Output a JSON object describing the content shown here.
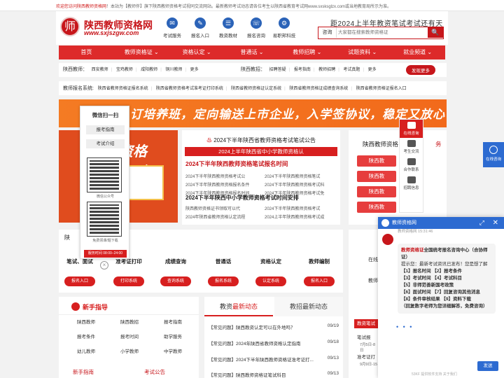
{
  "notice": {
    "highlight": "欢迎您访问陕西教师资格网",
    "text": "！本站为【教师伴】旗下陕西教师资格考试视同交流网站。最新教师考试动态请各位考生以陕西省教育考试网www.sxsksglzx.com或当地教育局所示为准。"
  },
  "header": {
    "logo_char": "师",
    "site_name": "陕西教师资格网",
    "site_url": "www.sxjszgw.com",
    "slogan": "距2024上半年教资笔试考试还有天",
    "quick": [
      {
        "label": "考试服务",
        "icon": "✉"
      },
      {
        "label": "报名入口",
        "icon": "✎"
      },
      {
        "label": "教资教材",
        "icon": "☰"
      },
      {
        "label": "报名咨询",
        "icon": "☏"
      },
      {
        "label": "易职邦科技",
        "icon": "⚙"
      }
    ],
    "search_label": "咨询",
    "search_placeholder": "大家都在搜索教师资格证",
    "search_icon": "🔍"
  },
  "nav": [
    "首页",
    "教师资格证 ⌄",
    "资格认定 ⌄",
    "普通话 ⌄",
    "教师招聘 ⌄",
    "试题资料 ⌄",
    "就业频道 ⌄"
  ],
  "region": {
    "title": "陕西教师：",
    "items": [
      "西安教师",
      "宝鸡教师",
      "咸阳教师",
      "铜川教师",
      "更多"
    ]
  },
  "recruit": {
    "title": "陕西教招：",
    "items": [
      "招聘答疑",
      "报考指南",
      "教师招聘",
      "考试真题",
      "更多"
    ],
    "button": "发现更多"
  },
  "system": {
    "title": "教师报名系统:",
    "items": [
      "陕西省教师资格证报名系统",
      "陕西省教师资格考试准考证打印系统",
      "陕西省教师资格证认定系统",
      "陕西省教师资格证成绩查询系统",
      "陕西省教师资格证报名入口"
    ]
  },
  "banner": {
    "text": "订培养班，定向输送上市企业，入学签协议，稳定又放心"
  },
  "promo": {
    "big": "资格",
    "sub": "包"
  },
  "qr": {
    "title": "微信扫一扫",
    "btn1": "报考指南",
    "btn2": "考试介绍",
    "cap1": "微信公众号",
    "cap2": "免费领课/题下载",
    "time": "服务时间 08:00–24:00"
  },
  "news": {
    "heading": "2024下半年陕西省教师资格考试笔试公告",
    "redbar": "2024上半年陕西省中小学教师资格认",
    "headline1": "2024下半年陕西教师资格笔试报名时间",
    "left1": [
      "2024下半年陕西教师资格考试公",
      "2024下半年陕西教师资格报名条件",
      "2024下半年陕西教师资格报名时间"
    ],
    "right1": [
      "2024下半年陕西教师资格笔试",
      "2024下半年陕西教师资格考试科",
      "2024下半年陕西教师资格考试免"
    ],
    "headline2": "2024下半年陕西中小学教师资格考试时间安排",
    "left2": [
      "陕西教师资格证书领取可以代",
      "2024年陕西省教师资格认定流程"
    ],
    "right2": [
      "2024下半年陕西教师资格考试",
      "2024上半年陕西教师资格考试成"
    ]
  },
  "right": {
    "title": "陕西教师资格",
    "more": "务",
    "boxes": [
      "陕西教",
      "陕西教",
      "陕西教",
      "陕西教"
    ]
  },
  "side": [
    {
      "label": "在线咨询"
    },
    {
      "label": "考生交流"
    },
    {
      "label": "合作联系"
    },
    {
      "label": "招聘信息"
    }
  ],
  "steps": {
    "head": "陕",
    "items": [
      {
        "t": "笔试、面试",
        "b": "报名入口"
      },
      {
        "t": "准考证打印",
        "b": "打印系统"
      },
      {
        "t": "成绩查询",
        "b": "查询系统"
      },
      {
        "t": "普通话",
        "b": "报名系统"
      },
      {
        "t": "资格认定",
        "b": "认定系统"
      },
      {
        "t": "教师编制",
        "b": "报名入口"
      }
    ]
  },
  "guide": {
    "title": "新手指导",
    "items": [
      "陕西教师",
      "陕西教招",
      "报考指南",
      "报考条件",
      "报考时间",
      "助学服务",
      "幼儿教师",
      "小学教师",
      "中学教师"
    ],
    "tab1": "新手指南",
    "tab2": "考试公告"
  },
  "dyn": {
    "tab_prefix": "教资",
    "tab_hl": "最新动态",
    "tab2": "教招最新动态",
    "rows": [
      {
        "t": "【常见问题】陕西教资认定可以在外地吗？",
        "d": "09/19"
      },
      {
        "t": "【常见问题】2024年陕西省教师资格认定指南",
        "d": "09/18"
      },
      {
        "t": "【常见问题】2024下半年陕西教师资格证准考证打...",
        "d": "09/13"
      },
      {
        "t": "【常见问题】陕西教师资格证笔试科目",
        "d": "09/13"
      }
    ]
  },
  "right2": {
    "tab": "教资笔试",
    "l1": "在线",
    "l2": "教师",
    "l3": "笔试报",
    "l3d": "7月5日-8日",
    "l4": "准考证打",
    "l4d": "9月9日-15"
  },
  "chat": {
    "title": "教师资格网",
    "sub": "教师资格网  15:31:46",
    "hl": "教师资格证",
    "hl2": "全国统考报名咨询中心（合协师证）",
    "intro": "提示您：最新考试资讯已发布！您是想了解",
    "lines": [
      "【1】报名时间 【2】报考条件",
      "【3】考试时间 【4】考试科目",
      "【5】非师范善新国考政策",
      "【6】面试时间 【7】回复咨询其他消息",
      "【8】条件审核结果 【9】资料下载",
      "（回复数字老师为您详细解答，免费咨询）"
    ],
    "send": "发送",
    "footer": "53KF 提供软件支持 关于我们"
  },
  "online": {
    "label": "在线咨询"
  }
}
